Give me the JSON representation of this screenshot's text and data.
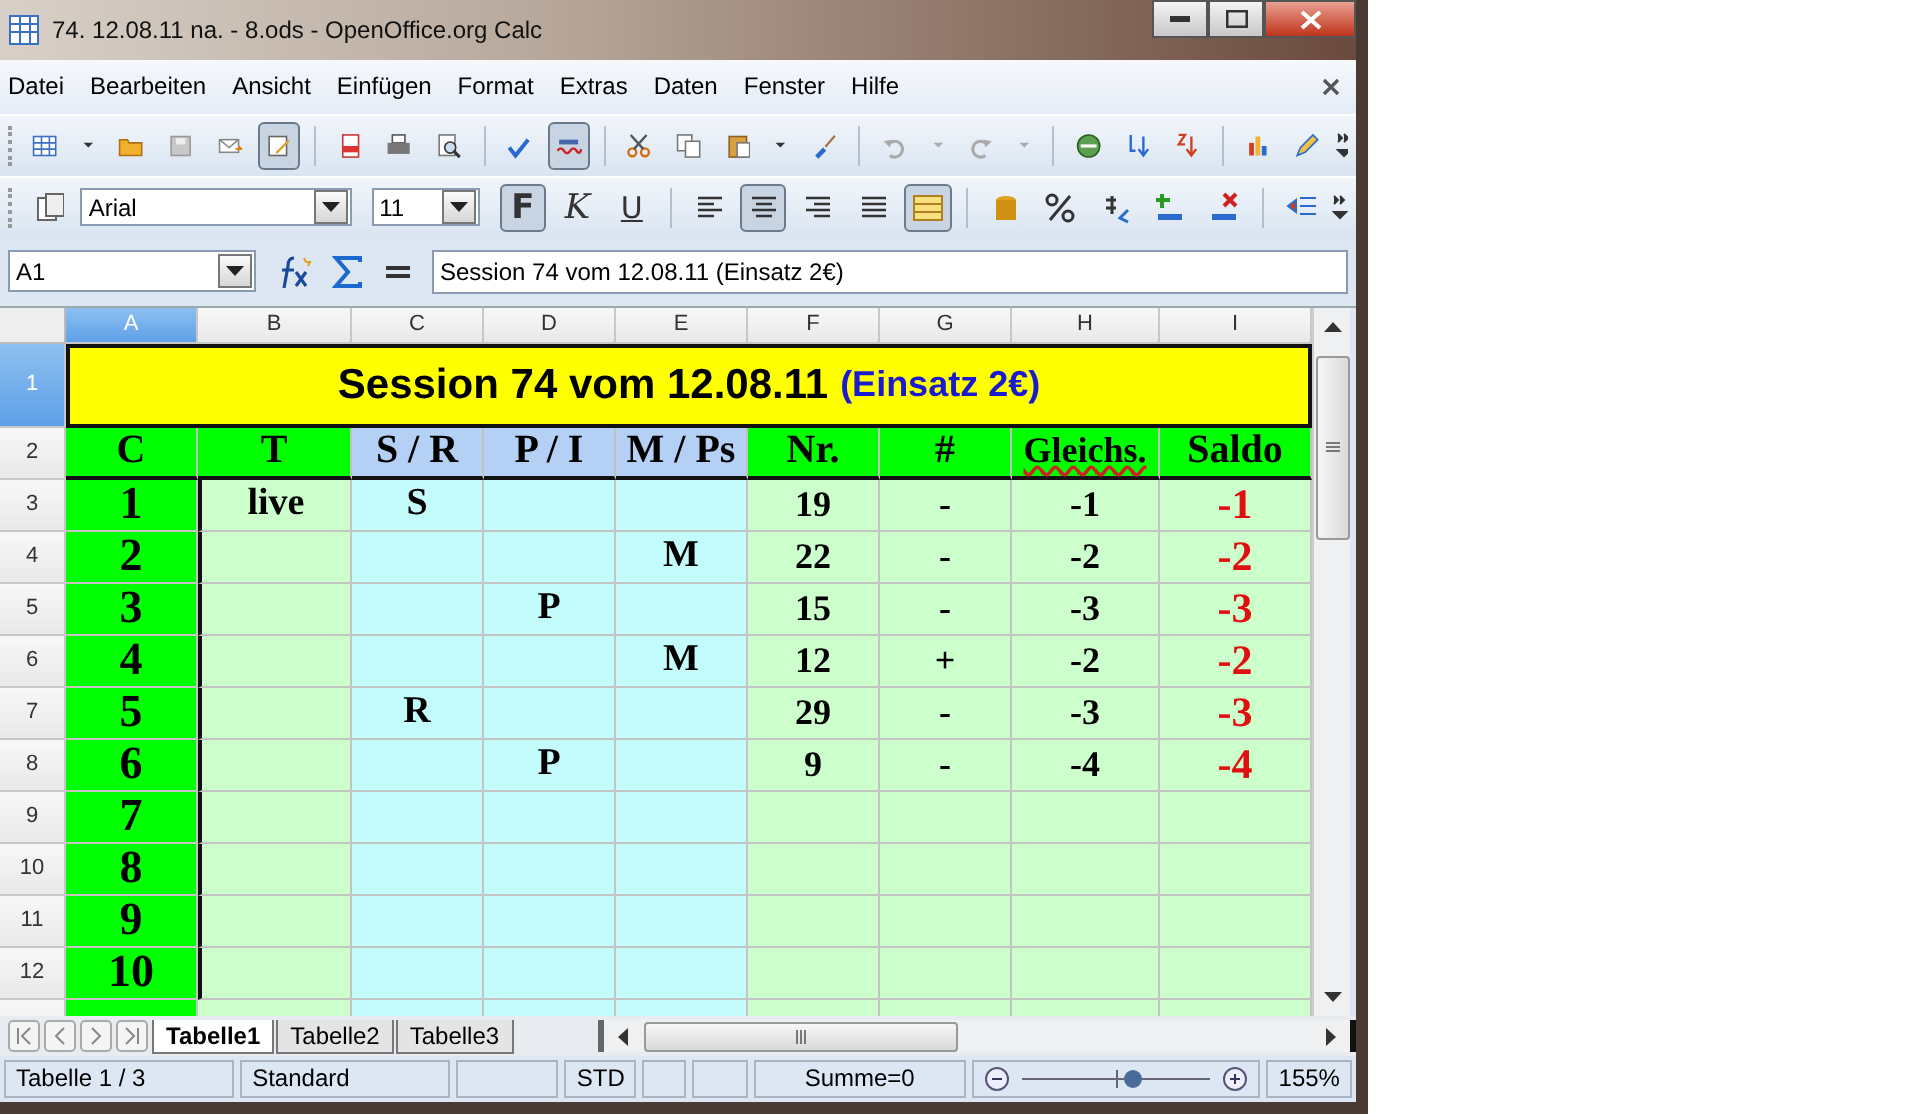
{
  "window": {
    "title": "74. 12.08.11 na. - 8.ods - OpenOffice.org Calc"
  },
  "menu": [
    "Datei",
    "Bearbeiten",
    "Ansicht",
    "Einfügen",
    "Format",
    "Extras",
    "Daten",
    "Fenster",
    "Hilfe"
  ],
  "formatting": {
    "font": "Arial",
    "size": "11",
    "styles": [
      {
        "label": "F",
        "kind": "bold",
        "selected": true
      },
      {
        "label": "K",
        "kind": "italic",
        "selected": false
      },
      {
        "label": "U",
        "kind": "underline",
        "selected": false
      }
    ],
    "align": [
      {
        "kind": "left",
        "selected": false
      },
      {
        "kind": "center",
        "selected": true
      },
      {
        "kind": "right",
        "selected": false
      },
      {
        "kind": "justify",
        "selected": false
      }
    ]
  },
  "formula_bar": {
    "cell": "A1",
    "value": "Session 74 vom 12.08.11 (Einsatz 2€)"
  },
  "columns": [
    {
      "label": "A",
      "selected": true
    },
    {
      "label": "B",
      "selected": false
    },
    {
      "label": "C",
      "selected": false
    },
    {
      "label": "D",
      "selected": false
    },
    {
      "label": "E",
      "selected": false
    },
    {
      "label": "F",
      "selected": false
    },
    {
      "label": "G",
      "selected": false
    },
    {
      "label": "H",
      "selected": false
    },
    {
      "label": "I",
      "selected": false
    }
  ],
  "title_row": {
    "row": "1",
    "selected": true,
    "text": "Session 74 vom 12.08.11",
    "note": "(Einsatz 2€)"
  },
  "header_row": {
    "row": "2",
    "cells": [
      {
        "text": "C",
        "color": "#00ff00"
      },
      {
        "text": "T",
        "color": "#00ff00"
      },
      {
        "text": "S / R",
        "color": "#b4d0f4"
      },
      {
        "text": "P / I",
        "color": "#b4d0f4"
      },
      {
        "text": "M / Ps",
        "color": "#b4d0f4"
      },
      {
        "text": "Nr.",
        "color": "#00ff00"
      },
      {
        "text": "#",
        "color": "#00ff00"
      },
      {
        "text": "Gleichs.",
        "color": "#00ff00"
      },
      {
        "text": "Saldo",
        "color": "#00ff00"
      }
    ]
  },
  "rows": [
    {
      "row": "3",
      "c": "1",
      "t": "live",
      "sr": "S",
      "nr": "19",
      "hash": "-",
      "gleichs": "-1",
      "saldo": "-1"
    },
    {
      "row": "4",
      "c": "2",
      "mps": "M",
      "nr": "22",
      "hash": "-",
      "gleichs": "-2",
      "saldo": "-2"
    },
    {
      "row": "5",
      "c": "3",
      "pi": "P",
      "nr": "15",
      "hash": "-",
      "gleichs": "-3",
      "saldo": "-3"
    },
    {
      "row": "6",
      "c": "4",
      "mps": "M",
      "nr": "12",
      "hash": "+",
      "gleichs": "-2",
      "saldo": "-2"
    },
    {
      "row": "7",
      "c": "5",
      "sr": "R",
      "nr": "29",
      "hash": "-",
      "gleichs": "-3",
      "saldo": "-3"
    },
    {
      "row": "8",
      "c": "6",
      "pi": "P",
      "nr": "9",
      "hash": "-",
      "gleichs": "-4",
      "saldo": "-4"
    },
    {
      "row": "9",
      "c": "7"
    },
    {
      "row": "10",
      "c": "8"
    },
    {
      "row": "11",
      "c": "9"
    },
    {
      "row": "12",
      "c": "10"
    }
  ],
  "sheet_tabs": [
    {
      "label": "Tabelle1",
      "selected": true
    },
    {
      "label": "Tabelle2",
      "selected": false
    },
    {
      "label": "Tabelle3",
      "selected": false
    }
  ],
  "status_bar": {
    "sheet": "Tabelle 1 / 3",
    "style": "Standard",
    "mode": "STD",
    "sum": "Summe=0",
    "zoom": {
      "level": 0.58
    },
    "zoom_text": "155%"
  }
}
